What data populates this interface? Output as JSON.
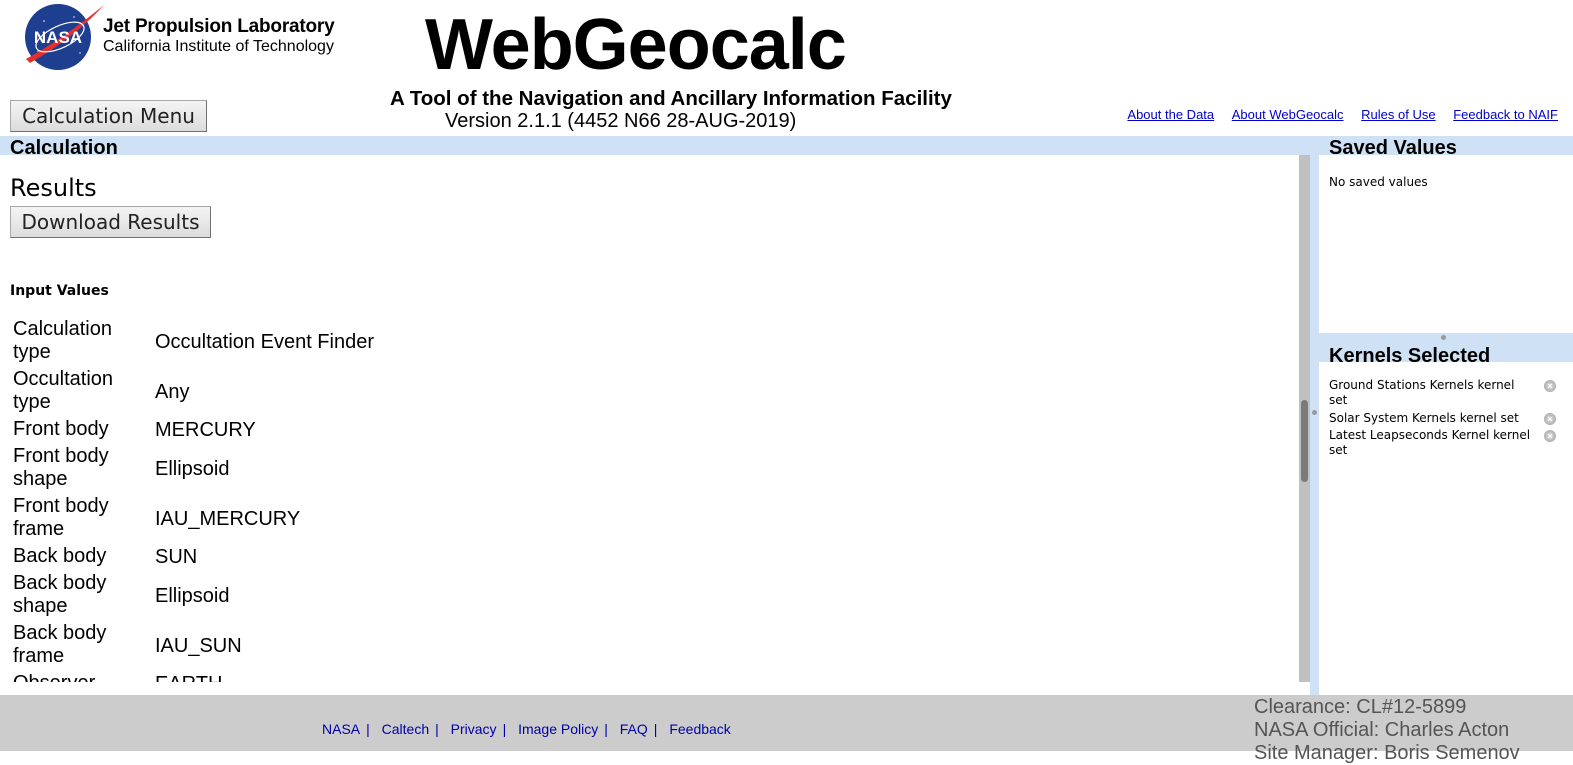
{
  "header": {
    "org_title": "Jet Propulsion Laboratory",
    "org_subtitle": "California Institute of Technology",
    "logo_text": "NASA",
    "app_title": "WebGeocalc",
    "tagline": "A Tool of the Navigation and Ancillary Information Facility",
    "version": "Version 2.1.1 (4452 N66 28-AUG-2019)",
    "calc_menu_button": "Calculation Menu",
    "links": [
      "About the Data",
      "About WebGeocalc",
      "Rules of Use",
      "Feedback to NAIF"
    ]
  },
  "main": {
    "section_title": "Calculation",
    "results_heading": "Results",
    "download_button": "Download Results",
    "input_values_heading": "Input Values",
    "inputs": [
      {
        "label": "Calculation type",
        "value": "Occultation Event Finder"
      },
      {
        "label": "Occultation type",
        "value": "Any"
      },
      {
        "label": "Front body",
        "value": "MERCURY"
      },
      {
        "label": "Front body shape",
        "value": "Ellipsoid"
      },
      {
        "label": "Front body frame",
        "value": "IAU_MERCURY"
      },
      {
        "label": "Back body",
        "value": "SUN"
      },
      {
        "label": "Back body shape",
        "value": "Ellipsoid"
      },
      {
        "label": "Back body frame",
        "value": "IAU_SUN"
      },
      {
        "label": "Observer",
        "value": "EARTH"
      }
    ]
  },
  "saved_values": {
    "title": "Saved Values",
    "empty_text": "No saved values"
  },
  "kernels": {
    "title": "Kernels Selected",
    "items": [
      {
        "label": "Ground Stations Kernels kernel set",
        "remove_icon": "remove-icon"
      },
      {
        "label": "Solar System Kernels kernel set",
        "remove_icon": "remove-icon"
      },
      {
        "label": "Latest Leapseconds Kernel kernel set",
        "remove_icon": "remove-icon"
      }
    ]
  },
  "footer": {
    "links": [
      "NASA",
      "Caltech",
      "Privacy",
      "Image Policy",
      "FAQ",
      "Feedback"
    ],
    "separator": "|",
    "clearance": "Clearance: CL#12-5899",
    "nasa_official": "NASA Official: Charles Acton",
    "site_manager": "Site Manager: Boris Semenov"
  },
  "colors": {
    "band": "#cfe2f5",
    "footer_bg": "#cccccc",
    "link": "#0000cc"
  }
}
